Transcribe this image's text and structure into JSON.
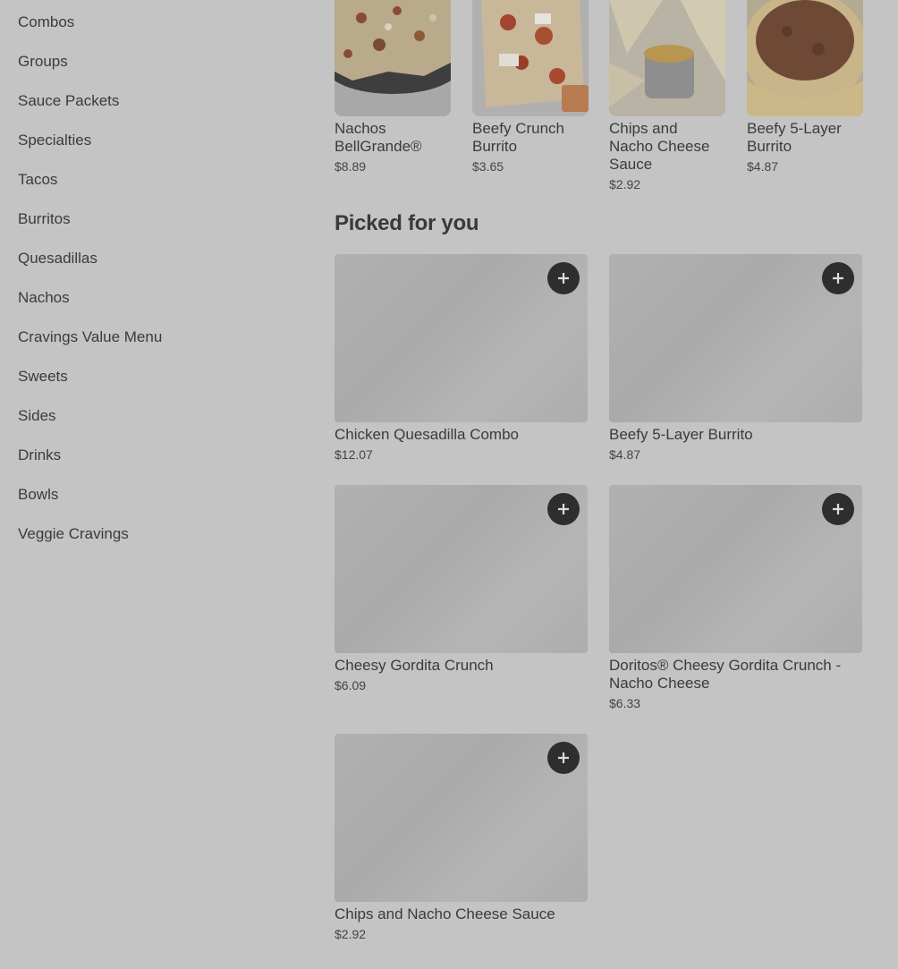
{
  "sidebar": {
    "categories": [
      "Combos",
      "Groups",
      "Sauce Packets",
      "Specialties",
      "Tacos",
      "Burritos",
      "Quesadillas",
      "Nachos",
      "Cravings Value Menu",
      "Sweets",
      "Sides",
      "Drinks",
      "Bowls",
      "Veggie Cravings"
    ]
  },
  "top_strip": [
    {
      "name": "Nachos BellGrande®",
      "price": "$8.89"
    },
    {
      "name": "Beefy Crunch Burrito",
      "price": "$3.65"
    },
    {
      "name": "Chips and Nacho Cheese Sauce",
      "price": "$2.92"
    },
    {
      "name": "Beefy 5-Layer Burrito",
      "price": "$4.87"
    }
  ],
  "picked": {
    "title": "Picked for you",
    "items": [
      {
        "name": "Chicken Quesadilla Combo",
        "price": "$12.07"
      },
      {
        "name": "Beefy 5-Layer Burrito",
        "price": "$4.87"
      },
      {
        "name": "Cheesy Gordita Crunch",
        "price": "$6.09"
      },
      {
        "name": "Doritos® Cheesy Gordita Crunch - Nacho Cheese",
        "price": "$6.33"
      },
      {
        "name": "Chips and Nacho Cheese Sauce",
        "price": "$2.92"
      }
    ],
    "add_icon": "plus-icon"
  },
  "colors": {
    "overlay_bg": "#c4c4c4",
    "text": "#3b3b3b",
    "button": "#2e2e2e"
  }
}
